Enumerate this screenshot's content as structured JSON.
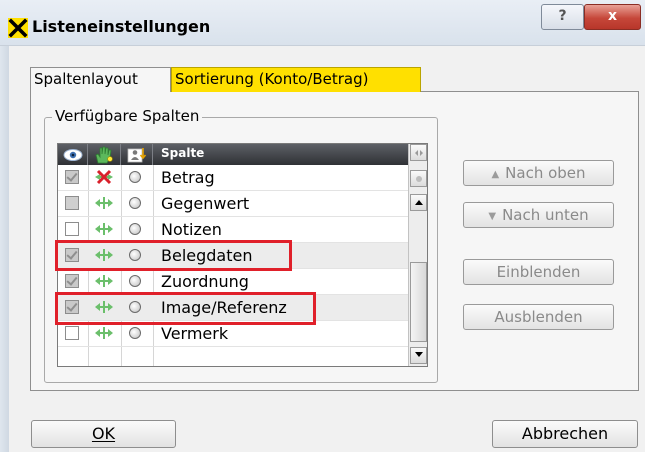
{
  "window": {
    "title": "Listeneinstellungen",
    "help_label": "?",
    "close_label": "x",
    "app_icon": "raiffeisen-x-logo-icon"
  },
  "tabs": [
    {
      "label": "Spaltenlayout",
      "active": true
    },
    {
      "label": "Sortierung (Konto/Betrag)",
      "active": false,
      "highlight_color": "#ffe000"
    }
  ],
  "group": {
    "label": "Verfügbare Spalten"
  },
  "list": {
    "header": {
      "visible_icon": "eye-icon",
      "move_icon": "hand-icon",
      "sort_icon": "sort-person-icon",
      "column_label": "Spalte"
    },
    "rows": [
      {
        "label": "Betrag",
        "checked": true,
        "col_icon": "locked-x-icon"
      },
      {
        "label": "Gegenwert",
        "checked": false,
        "col_icon": "resize-arrows-icon"
      },
      {
        "label": "Notizen",
        "checked": false,
        "col_icon": "resize-arrows-icon"
      },
      {
        "label": "Belegdaten",
        "checked": true,
        "col_icon": "resize-arrows-icon"
      },
      {
        "label": "Zuordnung",
        "checked": true,
        "col_icon": "resize-arrows-icon"
      },
      {
        "label": "Image/Referenz",
        "checked": true,
        "col_icon": "resize-arrows-icon"
      },
      {
        "label": "Vermerk",
        "checked": false,
        "col_icon": "resize-arrows-icon"
      }
    ],
    "highlighted_rows": [
      "Belegdaten",
      "Image/Referenz"
    ],
    "highlight_color": "#e0202a"
  },
  "side_buttons": {
    "up": "Nach oben",
    "down": "Nach unten",
    "show": "Einblenden",
    "hide": "Ausblenden"
  },
  "footer": {
    "ok": "OK",
    "cancel": "Abbrechen"
  }
}
